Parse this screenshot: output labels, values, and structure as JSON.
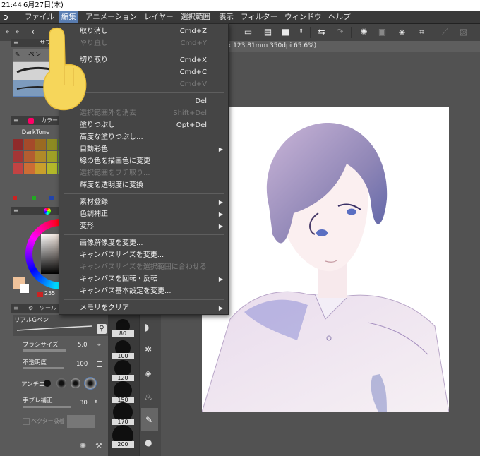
{
  "status": {
    "time": "21:44",
    "date": "6月27日(木)"
  },
  "menubar": {
    "items": [
      "ファイル",
      "編集",
      "アニメーション",
      "レイヤー",
      "選択範囲",
      "表示",
      "フィルター",
      "ウィンドウ",
      "ヘルプ"
    ],
    "active_index": 1
  },
  "canvas_tab": {
    "info": "x 123.81mm 350dpi 65.6%)"
  },
  "edit_menu": {
    "items": [
      {
        "label": "取り消し",
        "shortcut": "Cmd+Z",
        "enabled": true
      },
      {
        "label": "やり直し",
        "shortcut": "Cmd+Y",
        "enabled": false
      },
      {
        "sep": true
      },
      {
        "label": "切り取り",
        "shortcut": "Cmd+X",
        "enabled": true
      },
      {
        "label": "",
        "shortcut": "Cmd+C",
        "enabled": true
      },
      {
        "label": "",
        "shortcut": "Cmd+V",
        "enabled": false
      },
      {
        "sep": true
      },
      {
        "label": "",
        "shortcut": "Del",
        "enabled": true
      },
      {
        "label": "選択範囲外を消去",
        "shortcut": "Shift+Del",
        "enabled": false
      },
      {
        "label": "塗りつぶし",
        "shortcut": "Opt+Del",
        "enabled": true
      },
      {
        "label": "高度な塗りつぶし...",
        "shortcut": "",
        "enabled": true
      },
      {
        "label": "自動彩色",
        "shortcut": "",
        "enabled": true,
        "submenu": true
      },
      {
        "label": "線の色を描画色に変更",
        "shortcut": "",
        "enabled": true
      },
      {
        "label": "選択範囲をフチ取り...",
        "shortcut": "",
        "enabled": false
      },
      {
        "label": "輝度を透明度に変換",
        "shortcut": "",
        "enabled": true
      },
      {
        "sep": true
      },
      {
        "label": "素材登録",
        "shortcut": "",
        "enabled": true,
        "submenu": true
      },
      {
        "label": "色調補正",
        "shortcut": "",
        "enabled": true,
        "submenu": true
      },
      {
        "label": "変形",
        "shortcut": "",
        "enabled": true,
        "submenu": true
      },
      {
        "sep": true
      },
      {
        "label": "画像解像度を変更...",
        "shortcut": "",
        "enabled": true
      },
      {
        "label": "キャンバスサイズを変更...",
        "shortcut": "",
        "enabled": true
      },
      {
        "label": "キャンバスサイズを選択範囲に合わせる",
        "shortcut": "",
        "enabled": false
      },
      {
        "label": "キャンバスを回転・反転",
        "shortcut": "",
        "enabled": true,
        "submenu": true
      },
      {
        "label": "キャンバス基本設定を変更...",
        "shortcut": "",
        "enabled": true
      },
      {
        "sep": true
      },
      {
        "label": "メモリをクリア",
        "shortcut": "",
        "enabled": true,
        "submenu": true
      }
    ]
  },
  "left_panel": {
    "subtool_header": "サブツ",
    "pen_tab": "ペン",
    "color_header": "カラー",
    "color_set_name": "DarkTone",
    "tool_prop_header": "ツール",
    "brush_name": "リアルGペン",
    "props": {
      "brush_size": {
        "label": "ブラシサイズ",
        "value": "5.0"
      },
      "opacity": {
        "label": "不透明度",
        "value": "100"
      },
      "antialias": {
        "label": "アンチエ"
      },
      "stabilization": {
        "label": "手ブレ補正",
        "value": "30"
      },
      "vector_snap": {
        "label": "ベクター吸着"
      }
    },
    "partial_value": "255"
  },
  "brush_sizes": [
    "80",
    "100",
    "120",
    "150",
    "170",
    "200"
  ],
  "colors": {
    "accent": "#5b7fb4",
    "palette": [
      "#8f2b2b",
      "#a54a2a",
      "#9a6a22",
      "#8c8a22",
      "#4f7d2a",
      "#2b7d4a",
      "#236a7d",
      "#3a3f8a",
      "#5a2f7d",
      "#a43636",
      "#b35d30",
      "#b08a28",
      "#9ea126",
      "#5c9230",
      "#2f9660",
      "#2a7c99",
      "#3d4fa6",
      "#6d3999",
      "#c24343",
      "#cc6d35",
      "#c99f2c",
      "#b3b82a",
      "#6aa636",
      "#35ac70",
      "#3090b3",
      "#4158bd",
      "#7d42b0"
    ]
  }
}
